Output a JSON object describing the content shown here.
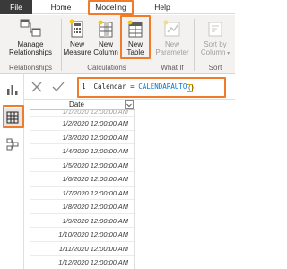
{
  "tabs": [
    {
      "label": "File"
    },
    {
      "label": "Home"
    },
    {
      "label": "Modeling"
    },
    {
      "label": "Help"
    }
  ],
  "ribbon": {
    "groups": [
      {
        "label": "Relationships",
        "buttons": [
          {
            "label_line1": "Manage",
            "label_line2": "Relationships"
          }
        ]
      },
      {
        "label": "Calculations",
        "buttons": [
          {
            "label_line1": "New",
            "label_line2": "Measure"
          },
          {
            "label_line1": "New",
            "label_line2": "Column"
          },
          {
            "label_line1": "New",
            "label_line2": "Table"
          }
        ]
      },
      {
        "label": "What If",
        "buttons": [
          {
            "label_line1": "New",
            "label_line2": "Parameter"
          }
        ]
      },
      {
        "label": "Sort",
        "buttons": [
          {
            "label_line1": "Sort by",
            "label_line2": "Column"
          }
        ]
      }
    ]
  },
  "formula": {
    "line_number": "1",
    "left": "Calendar = ",
    "function": "CALENDARAUTO",
    "args": "()"
  },
  "grid": {
    "column_header": "Date",
    "partial_row": "1/1/2020 12:00:00 AM",
    "rows": [
      "1/2/2020 12:00:00 AM",
      "1/3/2020 12:00:00 AM",
      "1/4/2020 12:00:00 AM",
      "1/5/2020 12:00:00 AM",
      "1/6/2020 12:00:00 AM",
      "1/7/2020 12:00:00 AM",
      "1/8/2020 12:00:00 AM",
      "1/9/2020 12:00:00 AM",
      "1/10/2020 12:00:00 AM",
      "1/11/2020 12:00:00 AM",
      "1/12/2020 12:00:00 AM"
    ]
  },
  "colors": {
    "highlight": "#f07b2b",
    "accent": "#f2c811",
    "function_blue": "#0078d4"
  }
}
